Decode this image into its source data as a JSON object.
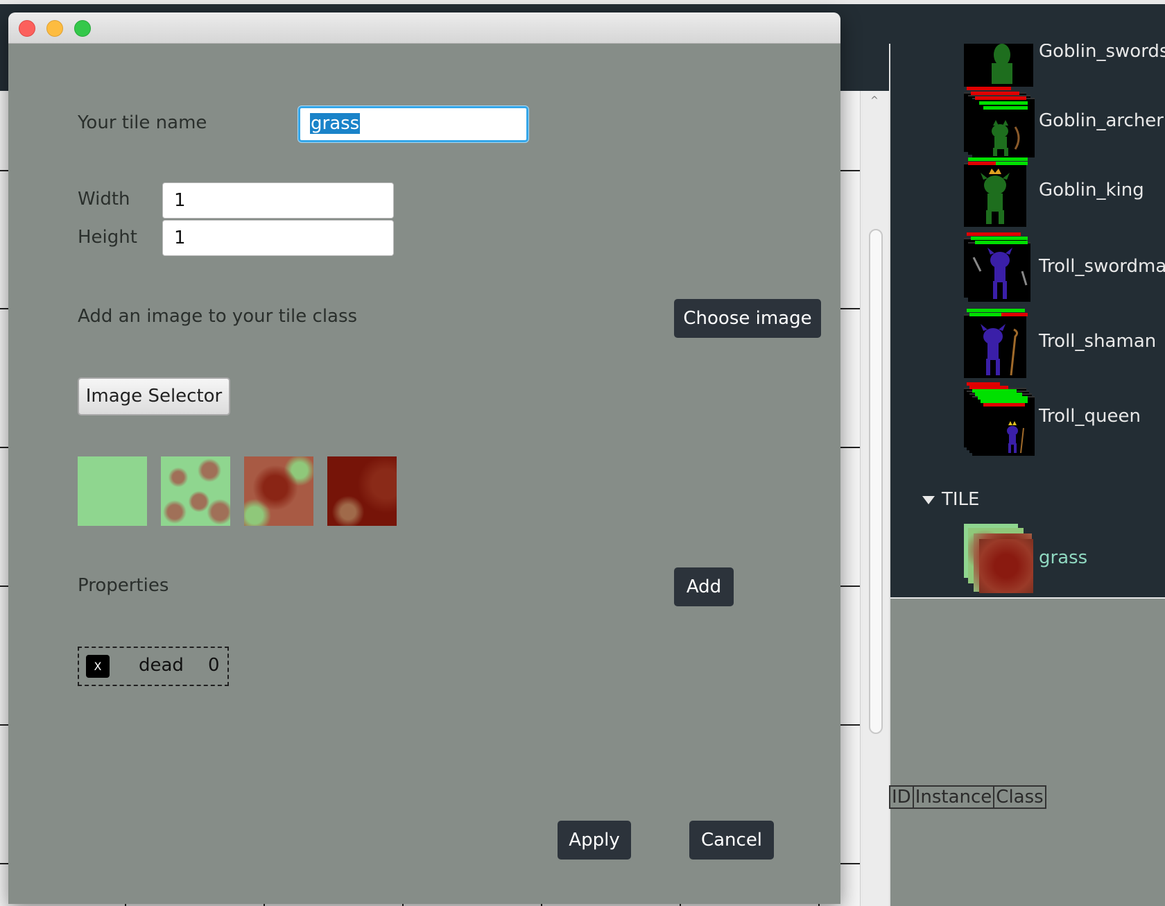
{
  "window": {
    "buttons": [
      "close",
      "minimize",
      "maximize"
    ]
  },
  "dialog": {
    "tile_name_label": "Your tile name",
    "tile_name_value": "grass",
    "width_label": "Width",
    "width_value": "1",
    "height_label": "Height",
    "height_value": "1",
    "image_prompt": "Add an image to your tile class",
    "choose_image_button": "Choose image",
    "image_selector_button": "Image Selector",
    "images": [
      {
        "name": "grass-light",
        "color": "#8fd68f"
      },
      {
        "name": "grass-mixed",
        "color": "#8fbf7c"
      },
      {
        "name": "grass-reddish",
        "color": "#9a4b37"
      },
      {
        "name": "grass-dead",
        "color": "#7a1a0c"
      }
    ],
    "properties_label": "Properties",
    "add_button": "Add",
    "properties": [
      {
        "remove_label": "X",
        "name": "dead",
        "value": "0"
      }
    ],
    "apply_button": "Apply",
    "cancel_button": "Cancel"
  },
  "tree": {
    "items": [
      {
        "label": "Goblin_swordsman"
      },
      {
        "label": "Goblin_archer"
      },
      {
        "label": "Goblin_king"
      },
      {
        "label": "Troll_swordman"
      },
      {
        "label": "Troll_shaman"
      },
      {
        "label": "Troll_queen"
      }
    ],
    "tile_section": "TILE",
    "tile_items": [
      {
        "label": "grass"
      }
    ]
  },
  "instance_table": {
    "columns": [
      "ID",
      "Instance",
      "Class"
    ]
  },
  "colors": {
    "dialog_bg": "#868d88",
    "dark_panel": "#232d34",
    "button_dark": "#2c333b",
    "focus_blue": "#35a6e8",
    "selection_text": "#8fd8c0",
    "goblin_green": "#1e6e1e",
    "troll_purple": "#3a1fa8",
    "hp_green": "#00e000",
    "hp_red": "#e00000"
  }
}
